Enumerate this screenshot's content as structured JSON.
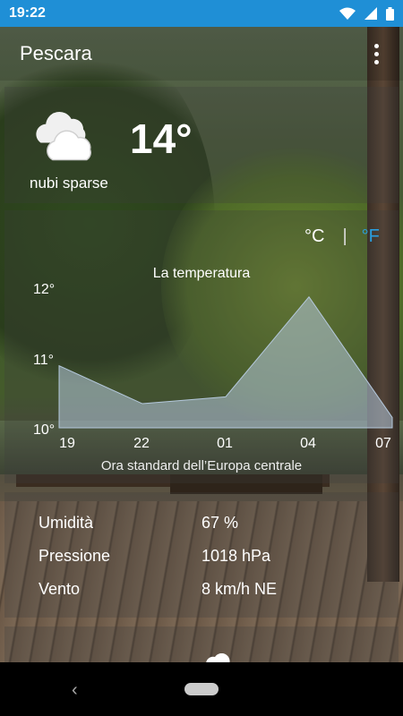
{
  "status_bar": {
    "time": "19:22"
  },
  "toolbar": {
    "city": "Pescara"
  },
  "current": {
    "temperature": "14°",
    "description": "nubi sparse"
  },
  "units": {
    "celsius": "°C",
    "separator": "|",
    "fahrenheit": "°F"
  },
  "chart_data": {
    "type": "area",
    "title": "La temperatura",
    "xlabel": "Ora standard dell’Europa centrale",
    "categories": [
      "19",
      "22",
      "01",
      "04",
      "07"
    ],
    "x_ticks": [
      "19",
      "22",
      "01",
      "04",
      "07"
    ],
    "y_ticks": [
      "12°",
      "11°",
      "10°"
    ],
    "ylim": [
      10,
      12
    ],
    "points": [
      {
        "x": "19",
        "y": 10.9
      },
      {
        "x": "22",
        "y": 10.35
      },
      {
        "x": "01",
        "y": 10.45
      },
      {
        "x": "04",
        "y": 11.9
      },
      {
        "x": "07",
        "y": 10.15
      }
    ],
    "fill_color": "#b4c8dc"
  },
  "details": [
    {
      "label": "Umidità",
      "value": "67 %"
    },
    {
      "label": "Pressione",
      "value": "1018 hPa"
    },
    {
      "label": "Vento",
      "value": "8 km/h NE"
    }
  ],
  "colors": {
    "status_bar": "#1f8fd6",
    "accent": "#2a9fe0"
  },
  "icons": [
    "wifi-icon",
    "signal-icon",
    "battery-icon",
    "overflow-menu-icon",
    "cloud-icon",
    "back-icon",
    "home-icon"
  ]
}
